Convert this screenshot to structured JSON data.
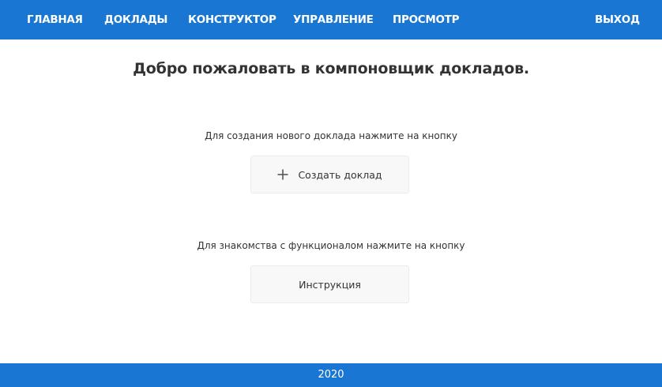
{
  "nav": {
    "items": [
      "ГЛАВНАЯ",
      "ДОКЛАДЫ",
      "КОНСТРУКТОР",
      "УПРАВЛЕНИЕ",
      "ПРОСМОТР"
    ],
    "logout": "ВЫХОД"
  },
  "main": {
    "title": "Добро пожаловать в компоновщик докладов.",
    "create_prompt": "Для создания нового доклада нажмите на кнопку",
    "create_button": "Создать доклад",
    "create_icon": "plus-icon",
    "help_prompt": "Для знакомства с функционалом нажмите на кнопку",
    "help_button": "Инструкция"
  },
  "footer": {
    "year": "2020"
  },
  "colors": {
    "primary": "#1976d2",
    "button_bg": "#f8f8f8",
    "text": "#333333"
  }
}
